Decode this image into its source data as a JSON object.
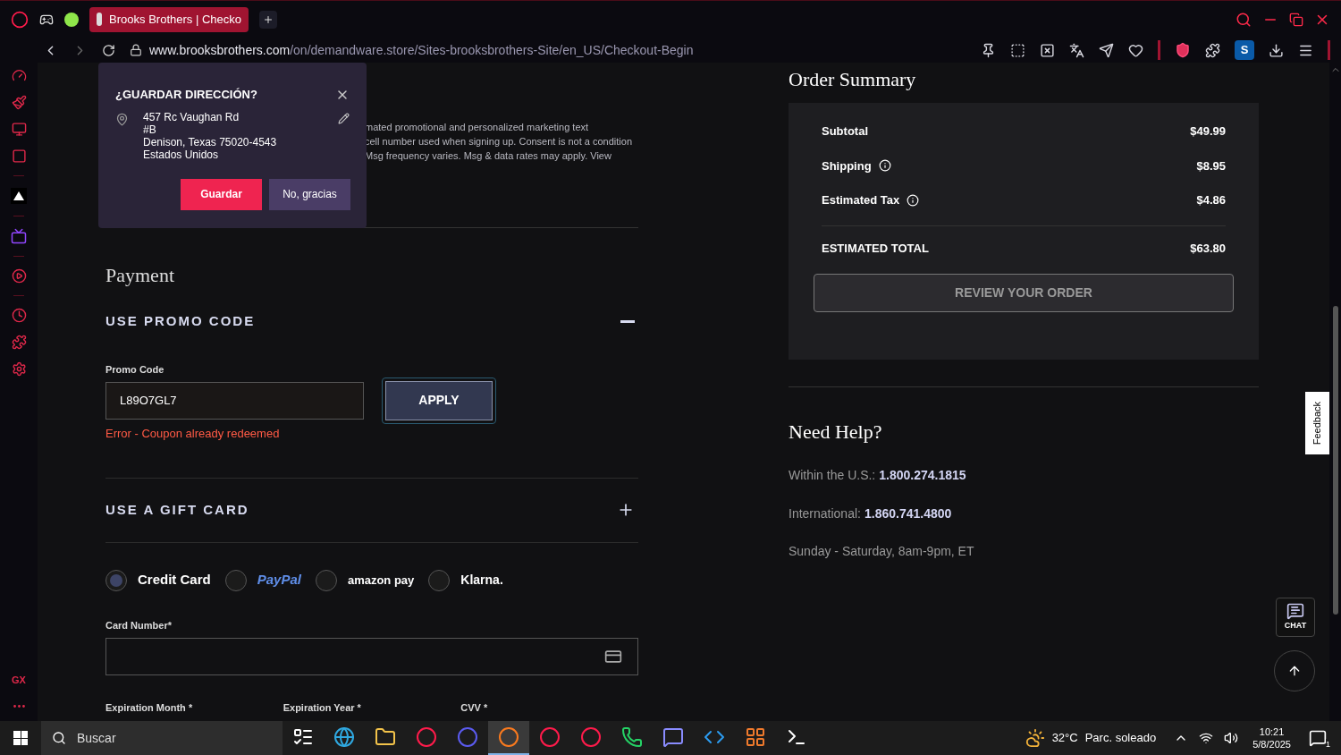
{
  "browser": {
    "tab_title": "Brooks Brothers | Checko",
    "url_domain": "www.brooksbrothers.com",
    "url_path": "/on/demandware.store/Sites-brooksbrothers-Site/en_US/Checkout-Begin",
    "profile_initial": "S",
    "sidebar_label": "GX"
  },
  "consent_fragments": [
    "mated promotional and personalized marketing text",
    "cell number used when signing up. Consent is not a condition",
    "Msg frequency varies. Msg & data rates may apply. View"
  ],
  "save_address_popup": {
    "title": "¿GUARDAR DIRECCIÓN?",
    "address_lines": [
      "457 Rc Vaughan Rd",
      "#B",
      "Denison, Texas 75020-4543",
      "Estados Unidos"
    ],
    "save_button": "Guardar",
    "decline_button": "No, gracias"
  },
  "payment": {
    "title": "Payment",
    "sections": [
      {
        "title": "USE PROMO CODE",
        "expanded": true
      },
      {
        "title": "USE A GIFT CARD",
        "expanded": false
      }
    ],
    "promo": {
      "label": "Promo Code",
      "value": "L89O7GL7",
      "apply_button": "APPLY",
      "error": "Error - Coupon already redeemed"
    },
    "methods": [
      {
        "kind": "text",
        "label": "Credit Card",
        "selected": true
      },
      {
        "kind": "paypal",
        "label": "PayPal",
        "selected": false
      },
      {
        "kind": "amazon",
        "label": "amazon pay",
        "selected": false
      },
      {
        "kind": "klarna",
        "label": "Klarna.",
        "selected": false
      }
    ],
    "card_number_label": "Card Number*",
    "field_labels": [
      "Expiration Month *",
      "Expiration Year *",
      "CVV *"
    ]
  },
  "order_summary": {
    "title": "Order Summary",
    "rows": [
      {
        "label": "Subtotal",
        "value": "$49.99",
        "info": false
      },
      {
        "label": "Shipping",
        "value": "$8.95",
        "info": true
      },
      {
        "label": "Estimated Tax",
        "value": "$4.86",
        "info": true
      }
    ],
    "total_label": "ESTIMATED TOTAL",
    "total_value": "$63.80",
    "review_button": "REVIEW YOUR ORDER"
  },
  "help": {
    "title": "Need Help?",
    "lines": [
      {
        "label": "Within the U.S.:",
        "phone": "1.800.274.1815"
      },
      {
        "label": "International:",
        "phone": "1.860.741.4800"
      }
    ],
    "hours": "Sunday - Saturday, 8am-9pm, ET"
  },
  "feedback_tab": "Feedback",
  "chat_button": "CHAT",
  "taskbar": {
    "search_placeholder": "Buscar",
    "apps": [
      {
        "kind": "taskview",
        "selected": false
      },
      {
        "kind": "edge",
        "selected": false
      },
      {
        "kind": "folder",
        "selected": false
      },
      {
        "kind": "opera",
        "selected": false
      },
      {
        "kind": "opera-blue",
        "selected": false
      },
      {
        "kind": "opera-gx",
        "selected": true
      },
      {
        "kind": "opera",
        "selected": false
      },
      {
        "kind": "opera",
        "selected": false
      },
      {
        "kind": "phone",
        "selected": false
      },
      {
        "kind": "chat",
        "selected": false
      },
      {
        "kind": "code",
        "selected": false
      },
      {
        "kind": "grid",
        "selected": false
      },
      {
        "kind": "terminal",
        "selected": false
      }
    ],
    "temperature": "32°C",
    "weather": "Parc. soleado",
    "time": "10:21",
    "date": "5/8/2025",
    "notifications": "1"
  }
}
